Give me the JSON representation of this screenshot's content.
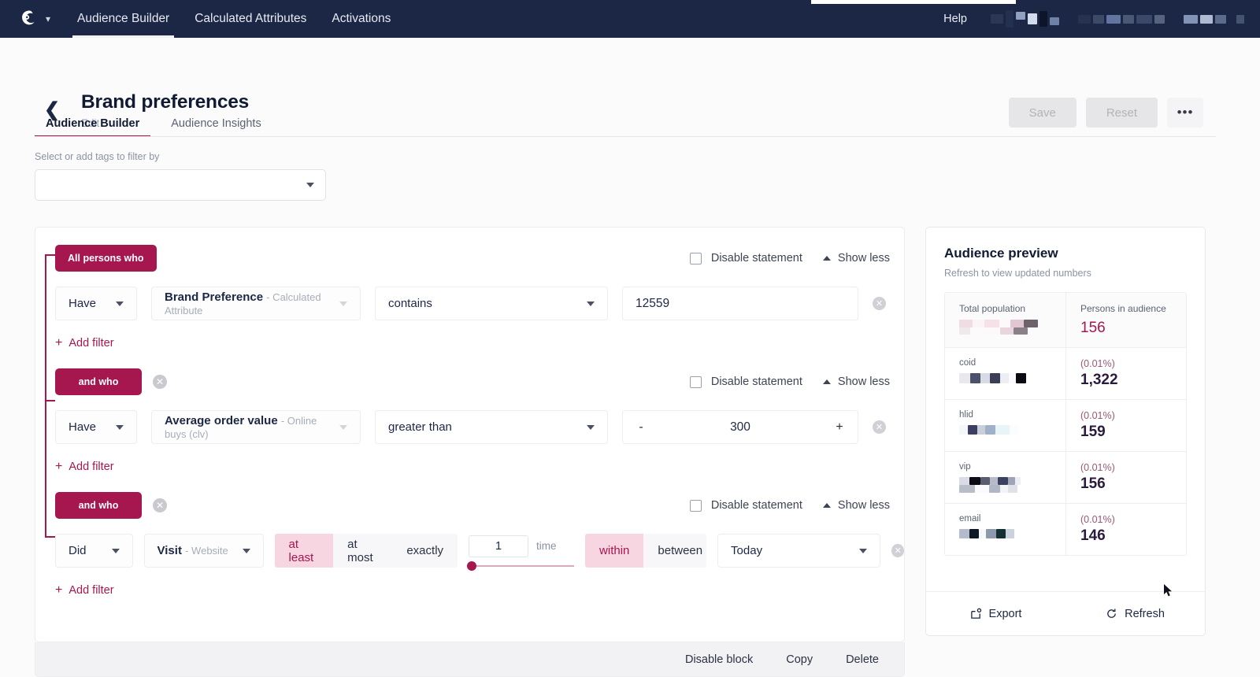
{
  "topnav": {
    "logo_icon": "owl-logo-icon",
    "dropdown_icon": "chevron-down-icon",
    "links": [
      {
        "label": "Audience Builder",
        "active": true
      },
      {
        "label": "Calculated Attributes",
        "active": false
      },
      {
        "label": "Activations",
        "active": false
      }
    ],
    "help_label": "Help"
  },
  "header": {
    "back_icon": "back-chevron-icon",
    "title": "Brand preferences",
    "subtitle": "Edit",
    "save_label": "Save",
    "reset_label": "Reset",
    "more_label": "•••"
  },
  "tabs": [
    {
      "label": "Audience Builder",
      "active": true
    },
    {
      "label": "Audience Insights",
      "active": false
    }
  ],
  "tag_filter": {
    "label": "Select or add tags to filter by",
    "value": "",
    "caret_icon": "chevron-down-icon"
  },
  "builder": {
    "statements": [
      {
        "pill": "All persons who",
        "removable": false,
        "disable_label": "Disable statement",
        "show_label": "Show less",
        "verb": "Have",
        "attribute_name": "Brand Preference",
        "attribute_meta": "- Calculated Attribute",
        "operator": "contains",
        "value": "12559",
        "add_filter": "Add filter",
        "kind": "text"
      },
      {
        "pill": "and who",
        "removable": true,
        "disable_label": "Disable statement",
        "show_label": "Show less",
        "verb": "Have",
        "attribute_name": "Average order value",
        "attribute_meta": "- Online buys (clv)",
        "operator": "greater than",
        "value": "300",
        "minus": "-",
        "plus": "+",
        "add_filter": "Add filter",
        "kind": "number"
      },
      {
        "pill": "and who",
        "removable": true,
        "disable_label": "Disable statement",
        "show_label": "Show less",
        "verb": "Did",
        "attribute_name": "Visit",
        "attribute_meta": "- Website",
        "frequency_options": [
          "at least",
          "at most",
          "exactly"
        ],
        "frequency_selected": "at least",
        "count_value": "1",
        "count_unit": "time",
        "range_options": [
          "within",
          "between"
        ],
        "range_selected": "within",
        "timeframe": "Today",
        "add_filter": "Add filter",
        "kind": "event"
      }
    ],
    "block_actions": [
      "Disable block",
      "Copy",
      "Delete"
    ]
  },
  "preview": {
    "title": "Audience preview",
    "subtitle": "Refresh to view updated numbers",
    "rows": [
      {
        "left_key": "Total population",
        "left_value": "",
        "left_blurred": true,
        "right_key": "Persons in audience",
        "right_pct": "",
        "right_value": "156",
        "accent": true
      },
      {
        "left_key": "coid",
        "left_value": "",
        "left_blurred": true,
        "right_key": "",
        "right_pct": "(0.01%)",
        "right_value": "1,322",
        "accent": false
      },
      {
        "left_key": "hlid",
        "left_value": "",
        "left_blurred": true,
        "right_key": "",
        "right_pct": "(0.01%)",
        "right_value": "159",
        "accent": false
      },
      {
        "left_key": "vip",
        "left_value": "",
        "left_blurred": true,
        "right_key": "",
        "right_pct": "(0.01%)",
        "right_value": "156",
        "accent": false
      },
      {
        "left_key": "email",
        "left_value": "",
        "left_blurred": true,
        "right_key": "",
        "right_pct": "(0.01%)",
        "right_value": "146",
        "accent": false
      }
    ],
    "export_label": "Export",
    "export_icon": "export-icon",
    "refresh_label": "Refresh",
    "refresh_icon": "refresh-icon"
  },
  "colors": {
    "nav_bg": "#1b2744",
    "accent": "#a6164f",
    "accent_soft": "#f7d6e1",
    "text_dark": "#101a33",
    "muted": "#8b93a3"
  }
}
